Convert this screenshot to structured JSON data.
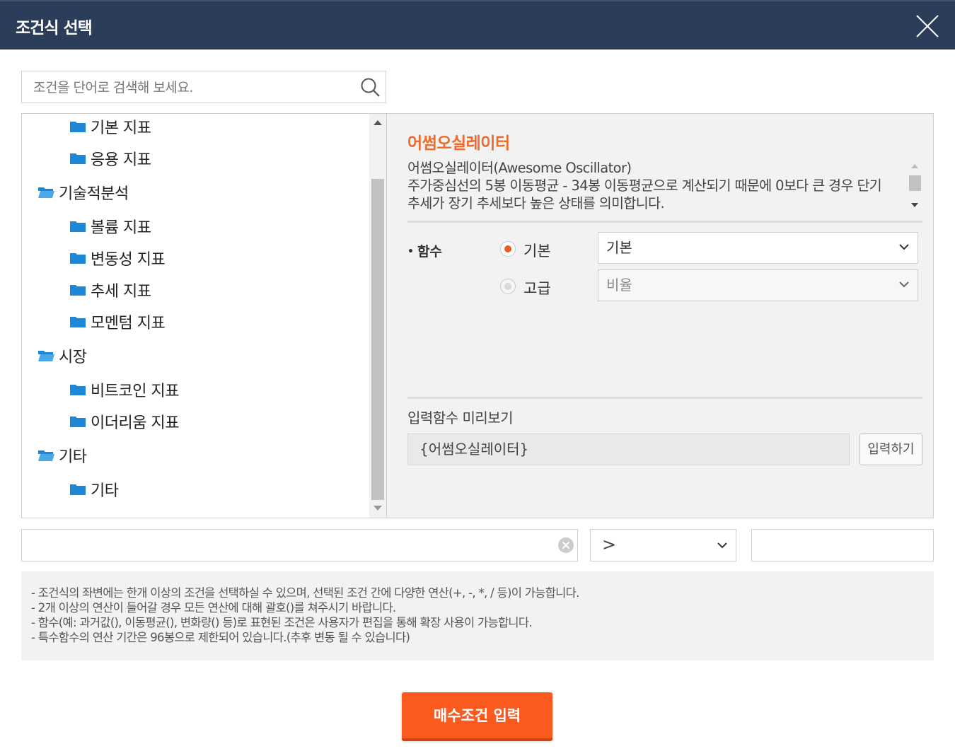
{
  "header": {
    "title": "조건식 선택",
    "close_icon": "close-icon"
  },
  "search": {
    "placeholder": "조건을 단어로 검색해 보세요.",
    "icon": "search-icon"
  },
  "tree": {
    "items": [
      {
        "label": "기본 지표",
        "level": 2
      },
      {
        "label": "응용 지표",
        "level": 2
      },
      {
        "label": "기술적분석",
        "level": 1,
        "open": true
      },
      {
        "label": "볼륨 지표",
        "level": 2
      },
      {
        "label": "변동성 지표",
        "level": 2
      },
      {
        "label": "추세 지표",
        "level": 2
      },
      {
        "label": "모멘텀 지표",
        "level": 2
      },
      {
        "label": "시장",
        "level": 1,
        "open": true
      },
      {
        "label": "비트코인 지표",
        "level": 2
      },
      {
        "label": "이더리움 지표",
        "level": 2
      },
      {
        "label": "기타",
        "level": 1,
        "open": true
      },
      {
        "label": "기타",
        "level": 2
      }
    ]
  },
  "detail": {
    "title": "어썸오실레이터",
    "description": [
      "어썸오실레이터(Awesome Oscillator)",
      "주가중심선의 5봉 이동평균 - 34봉 이동평균으로 계산되기 때문에 0보다 큰 경우 단기",
      "추세가 장기 추세보다 높은 상태를 의미합니다."
    ],
    "function_label": "함수",
    "options": [
      {
        "label": "기본",
        "selected": true,
        "select_value": "기본",
        "enabled": true
      },
      {
        "label": "고급",
        "selected": false,
        "select_value": "비율",
        "enabled": false
      }
    ],
    "preview_label": "입력함수 미리보기",
    "preview_value": "{어썸오실레이터}",
    "input_button": "입력하기"
  },
  "condition": {
    "left_value": "",
    "operator": ">",
    "right_value": ""
  },
  "notes": [
    "- 조건식의 좌변에는 한개 이상의 조건을 선택하실 수 있으며, 선택된 조건 간에 다양한 연산(+, -, *, / 등)이 가능합니다.",
    "- 2개 이상의 연산이 들어갈 경우 모든 연산에 대해 괄호()를 쳐주시기 바랍니다.",
    "- 함수(예: 과거값(), 이동평균(), 변화량() 등)로 표현된 조건은 사용자가 편집을 통해 확장 사용이 가능합니다.",
    "- 특수함수의 연산 기간은 96봉으로 제한되어 있습니다.(추후 변동 될 수 있습니다)"
  ],
  "submit_button": "매수조건 입력",
  "colors": {
    "header_bg": "#2b3d58",
    "accent": "#ee6a2c",
    "button": "#fa5a1e",
    "folder": "#1e88d8",
    "folder_open": "#4aa8e8"
  }
}
